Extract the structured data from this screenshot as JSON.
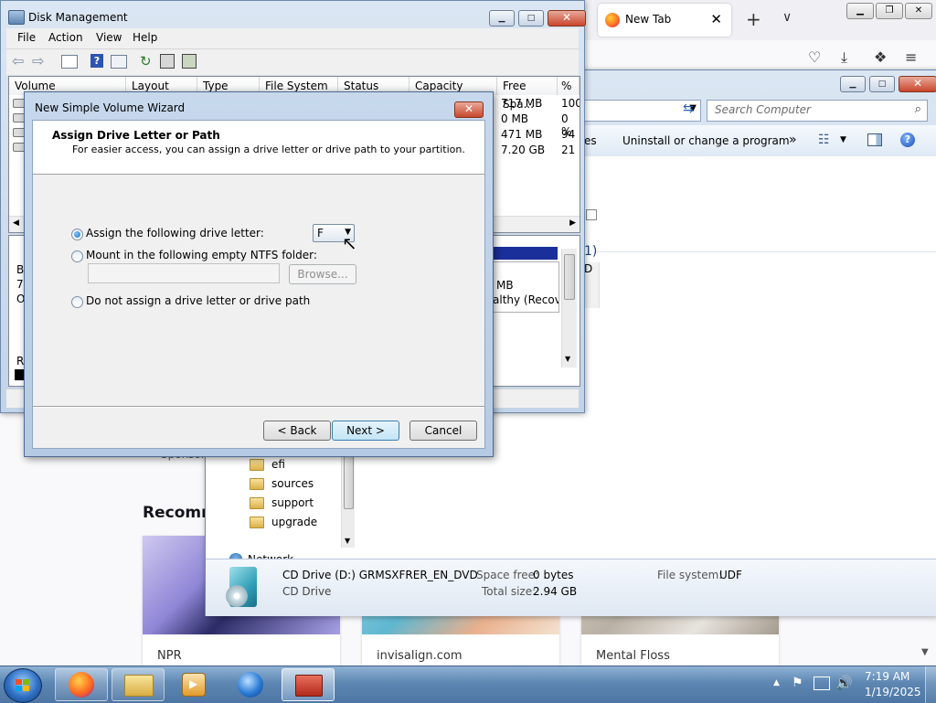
{
  "firefox": {
    "tab_title": "New Tab",
    "tab_close": "✕",
    "new_tab": "+",
    "list_tabs": "⌄",
    "section_recommended": "Recomm",
    "sponsored_fragment": "Sponsore",
    "tiles": [
      {
        "name": "NPR"
      },
      {
        "name": "invisalign.com"
      },
      {
        "name": "Mental Floss"
      }
    ]
  },
  "explorer": {
    "search_placeholder": "Search Computer",
    "cmd_uninstall": "Uninstall or change a program",
    "cmd_fragment": "es",
    "cmd_more": "»",
    "panel_fragment_1": "1)",
    "panel_fragment_2": "D",
    "folders": [
      "efi",
      "sources",
      "support",
      "upgrade"
    ],
    "network_label": "Network",
    "details": {
      "drive_name": "CD Drive (D:) GRMSXFRER_EN_DVD",
      "drive_type": "CD Drive",
      "space_free_label": "Space free:",
      "space_free_value": "0 bytes",
      "total_size_label": "Total size:",
      "total_size_value": "2.94 GB",
      "file_system_label": "File system:",
      "file_system_value": "UDF"
    }
  },
  "disk_management": {
    "title": "Disk Management",
    "menu": [
      "File",
      "Action",
      "View",
      "Help"
    ],
    "columns": [
      "Volume",
      "Layout",
      "Type",
      "File System",
      "Status",
      "Capacity",
      "Free Spa...",
      "% F"
    ],
    "free_space": [
      "717 MB",
      "0 MB",
      "471 MB",
      "7.20 GB"
    ],
    "percent_free": [
      "100",
      "0 %",
      "94",
      "21"
    ],
    "graph_fragments": {
      "left_1": "B",
      "left_2": "7(",
      "left_3": "O",
      "left_4": "R",
      "mb": "MB",
      "healthy": "althy (Recov"
    }
  },
  "wizard": {
    "title": "New Simple Volume Wizard",
    "heading": "Assign Drive Letter or Path",
    "subheading": "For easier access, you can assign a drive letter or drive path to your partition.",
    "options": {
      "assign_letter": "Assign the following drive letter:",
      "mount_folder": "Mount in the following empty NTFS folder:",
      "no_assign": "Do not assign a drive letter or drive path"
    },
    "selected_letter": "F",
    "browse": "Browse...",
    "back": "< Back",
    "next": "Next >",
    "cancel": "Cancel"
  },
  "taskbar": {
    "time": "7:19 AM",
    "date": "1/19/2025"
  }
}
